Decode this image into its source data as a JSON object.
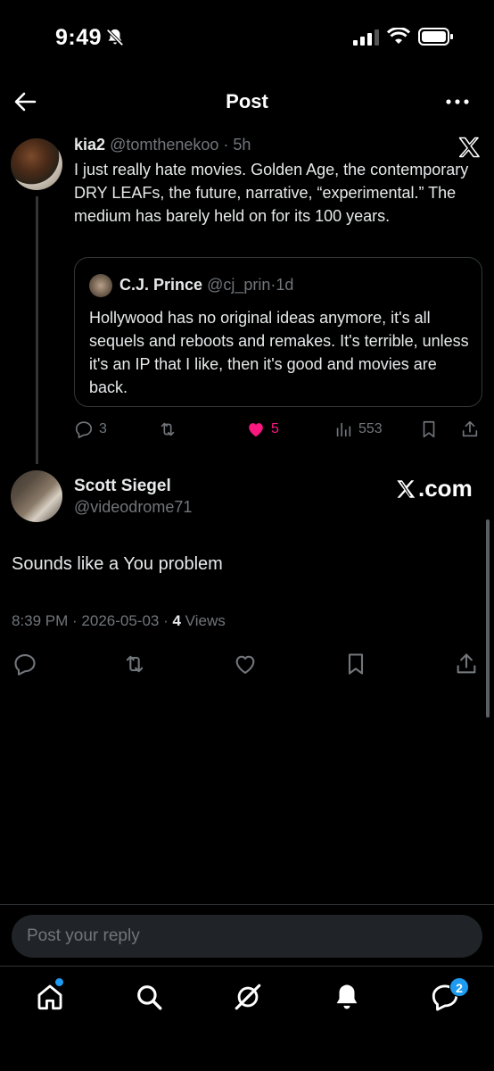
{
  "status_bar": {
    "time": "9:49"
  },
  "header": {
    "title": "Post"
  },
  "parent_post": {
    "name": "kia2",
    "handle": "@tomthenekoo",
    "age": "5h",
    "text": "I just really hate movies. Golden Age, the contemporary DRY LEAFs, the future, narrative, “experimental.”  The medium has barely held on for its 100 years.",
    "quote": {
      "name": "C.J. Prince",
      "handle": "@cj_prin",
      "age": "1d",
      "text": "Hollywood has no original ideas anymore, it's all sequels and reboots and remakes. It's terrible, unless it's an IP that I like, then it's good and movies are back."
    },
    "stats": {
      "replies": "3",
      "likes": "5",
      "views": "553"
    }
  },
  "main_post": {
    "name": "Scott Siegel",
    "handle": "@videodrome71",
    "source_label": ".com",
    "text": "Sounds like a You problem",
    "timestamp": "8:39 PM · 2026-05-03 · ",
    "views_count": "4",
    "views_label": " Views"
  },
  "reply": {
    "placeholder": "Post your reply"
  },
  "nav": {
    "messages_badge": "2"
  },
  "colors": {
    "accent": "#1d9bf0",
    "like": "#f91880",
    "muted": "#71767b",
    "background": "#000000"
  }
}
